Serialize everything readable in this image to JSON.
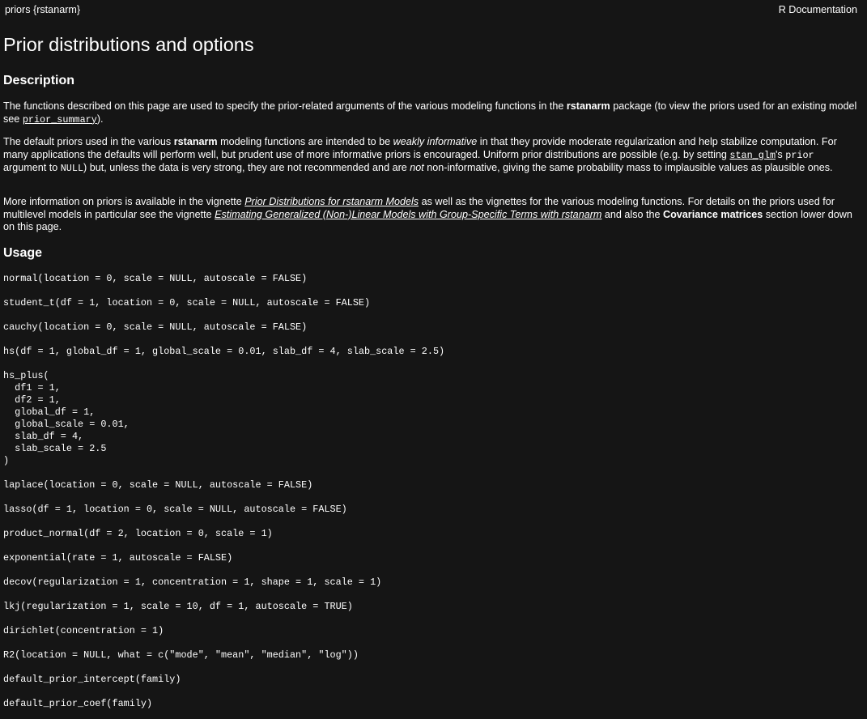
{
  "header": {
    "left": "priors {rstanarm}",
    "right": "R Documentation"
  },
  "title": "Prior distributions and options",
  "description": {
    "heading": "Description",
    "p1": {
      "text1": "The functions described on this page are used to specify the prior-related arguments of the various modeling functions in the ",
      "bold1": "rstanarm",
      "text2": " package (to view the priors used for an existing model see ",
      "code_link": "prior_summary",
      "text3": ")."
    },
    "p2": {
      "text1": "The default priors used in the various ",
      "bold1": "rstanarm",
      "text2": " modeling functions are intended to be ",
      "italic1": "weakly informative",
      "text3": " in that they provide moderate regularization and help stabilize computation. For many applications the defaults will perform well, but prudent use of more informative priors is encouraged. Uniform prior distributions are possible (e.g. by setting ",
      "code_link": "stan_glm",
      "text4": "'s ",
      "code1": "prior",
      "text5": " argument to ",
      "code2": "NULL",
      "text6": ") but, unless the data is very strong, they are not recommended and are ",
      "italic2": "not",
      "text7": " non-informative, giving the same probability mass to implausible values as plausible ones."
    },
    "p3": {
      "text1": "More information on priors is available in the vignette ",
      "link1": "Prior Distributions for rstanarm Models",
      "text2": " as well as the vignettes for the various modeling functions. For details on the priors used for multilevel models in particular see the vignette ",
      "link2": "Estimating Generalized (Non-)Linear Models with Group-Specific Terms with rstanarm",
      "text3": " and also the ",
      "bold1": "Covariance matrices",
      "text4": " section lower down on this page."
    }
  },
  "usage": {
    "heading": "Usage",
    "blocks": [
      [
        "normal(location = 0, scale = NULL, autoscale = FALSE)"
      ],
      [
        "student_t(df = 1, location = 0, scale = NULL, autoscale = FALSE)"
      ],
      [
        "cauchy(location = 0, scale = NULL, autoscale = FALSE)"
      ],
      [
        "hs(df = 1, global_df = 1, global_scale = 0.01, slab_df = 4, slab_scale = 2.5)"
      ],
      [
        "hs_plus(",
        "  df1 = 1,",
        "  df2 = 1,",
        "  global_df = 1,",
        "  global_scale = 0.01,",
        "  slab_df = 4,",
        "  slab_scale = 2.5",
        ")"
      ],
      [
        "laplace(location = 0, scale = NULL, autoscale = FALSE)"
      ],
      [
        "lasso(df = 1, location = 0, scale = NULL, autoscale = FALSE)"
      ],
      [
        "product_normal(df = 2, location = 0, scale = 1)"
      ],
      [
        "exponential(rate = 1, autoscale = FALSE)"
      ],
      [
        "decov(regularization = 1, concentration = 1, shape = 1, scale = 1)"
      ],
      [
        "lkj(regularization = 1, scale = 10, df = 1, autoscale = TRUE)"
      ],
      [
        "dirichlet(concentration = 1)"
      ],
      [
        "R2(location = NULL, what = c(\"mode\", \"mean\", \"median\", \"log\"))"
      ],
      [
        "default_prior_intercept(family)"
      ],
      [
        "default_prior_coef(family)"
      ]
    ]
  }
}
